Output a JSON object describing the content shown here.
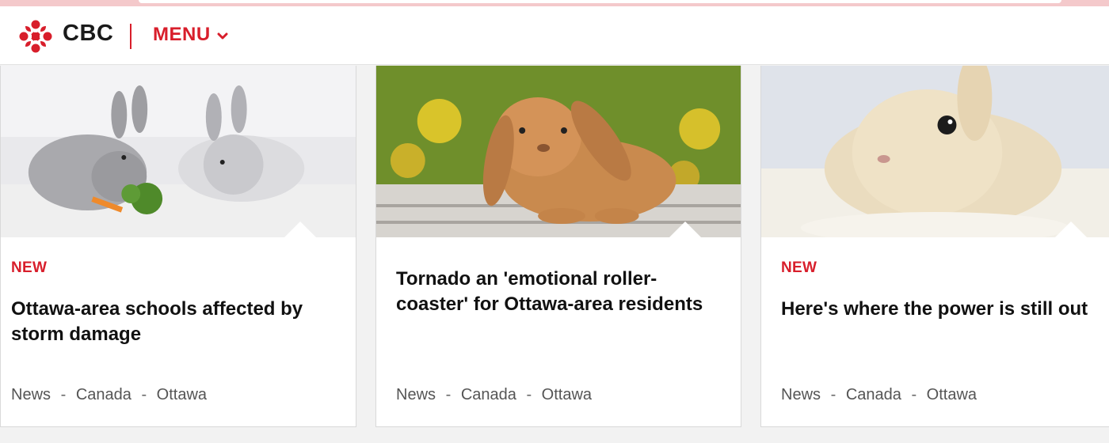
{
  "header": {
    "brand": "CBC",
    "menu_label": "MENU"
  },
  "colors": {
    "brand_red": "#d81e2b",
    "text_dark": "#111111",
    "meta_gray": "#555555"
  },
  "icons": {
    "logo": "cbc-gem-icon",
    "menu_chevron": "chevron-down-icon"
  },
  "cards": [
    {
      "badge": "NEW",
      "headline": "Ottawa-area schools affected by storm damage",
      "breadcrumbs": [
        "News",
        "Canada",
        "Ottawa"
      ],
      "separator": "-"
    },
    {
      "badge": "",
      "headline": "Tornado an 'emotional roller-coaster' for Ottawa-area residents",
      "breadcrumbs": [
        "News",
        "Canada",
        "Ottawa"
      ],
      "separator": "-"
    },
    {
      "badge": "NEW",
      "headline": "Here's where the power is still out",
      "breadcrumbs": [
        "News",
        "Canada",
        "Ottawa"
      ],
      "separator": "-"
    }
  ]
}
